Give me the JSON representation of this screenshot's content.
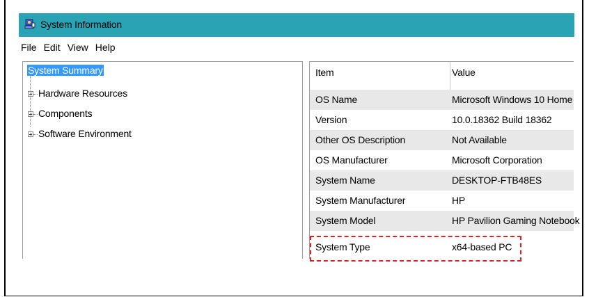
{
  "window": {
    "title": "System Information",
    "icon": "system-information-icon"
  },
  "menu": [
    "File",
    "Edit",
    "View",
    "Help"
  ],
  "tree": {
    "selected": "System Summary",
    "children": [
      "Hardware Resources",
      "Components",
      "Software Environment"
    ]
  },
  "table": {
    "headers": {
      "item": "Item",
      "value": "Value"
    },
    "rows": [
      {
        "item": "OS Name",
        "value": "Microsoft Windows 10 Home"
      },
      {
        "item": "Version",
        "value": "10.0.18362 Build 18362"
      },
      {
        "item": "Other OS Description",
        "value": "Not Available"
      },
      {
        "item": "OS Manufacturer",
        "value": "Microsoft Corporation"
      },
      {
        "item": "System Name",
        "value": "DESKTOP-FTB48ES"
      },
      {
        "item": "System Manufacturer",
        "value": "HP"
      },
      {
        "item": "System Model",
        "value": "HP Pavilion Gaming Notebook"
      },
      {
        "item": "System Type",
        "value": "x64-based PC"
      }
    ]
  },
  "colors": {
    "titlebar": "#2aa3b5",
    "selection": "#3399ff",
    "annotation": "#e02020",
    "alt_row": "#e8e8e8"
  }
}
